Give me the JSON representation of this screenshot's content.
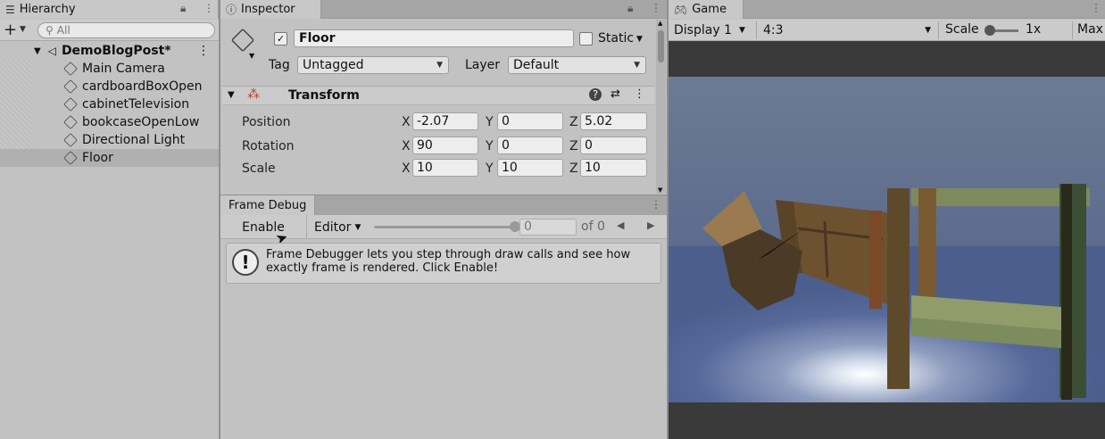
{
  "hierarchy": {
    "tab_label": "Hierarchy",
    "search_placeholder": "All",
    "scene_name": "DemoBlogPost*",
    "objects": [
      {
        "label": "Main Camera"
      },
      {
        "label": "cardboardBoxOpen"
      },
      {
        "label": "cabinetTelevision"
      },
      {
        "label": "bookcaseOpenLow"
      },
      {
        "label": "Directional Light"
      },
      {
        "label": "Floor"
      }
    ],
    "selected": "Floor"
  },
  "inspector": {
    "tab_label": "Inspector",
    "object_name": "Floor",
    "active": true,
    "static_label": "Static",
    "tag_label": "Tag",
    "tag_value": "Untagged",
    "layer_label": "Layer",
    "layer_value": "Default",
    "component_title": "Transform",
    "position_label": "Position",
    "rotation_label": "Rotation",
    "scale_label": "Scale",
    "axis_x": "X",
    "axis_y": "Y",
    "axis_z": "Z",
    "position": {
      "x": "-2.07",
      "y": "0",
      "z": "5.02"
    },
    "rotation": {
      "x": "90",
      "y": "0",
      "z": "0"
    },
    "scale": {
      "x": "10",
      "y": "10",
      "z": "10"
    }
  },
  "frame_debug": {
    "tab_label": "Frame Debug",
    "enable_label": "Enable",
    "editor_label": "Editor",
    "slider_value": "0",
    "of_label": "of 0",
    "message": "Frame Debugger lets you step through draw calls and see how exactly frame is rendered. Click Enable!"
  },
  "game": {
    "tab_label": "Game",
    "display": "Display 1",
    "aspect": "4:3",
    "scale_label": "Scale",
    "scale_value": "1x",
    "maximize_label": "Max"
  },
  "colors": {
    "sky": "#6a7894",
    "floor": "#4b5e8c",
    "wood": "#8a6a3d",
    "cushion": "#7a8a5a"
  }
}
